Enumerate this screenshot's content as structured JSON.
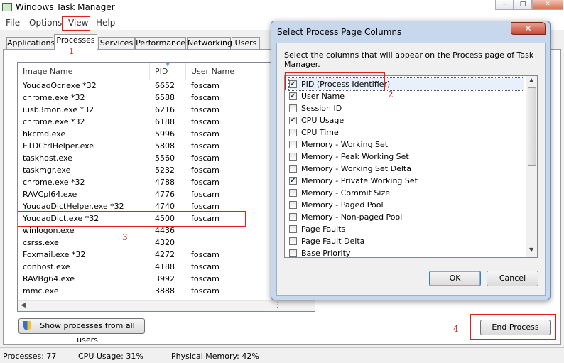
{
  "window": {
    "title": "Windows Task Manager"
  },
  "caption_buttons": [
    "–",
    "□",
    "✕"
  ],
  "menu": [
    "File",
    "Options",
    "View",
    "Help"
  ],
  "tabs": [
    "Applications",
    "Processes",
    "Services",
    "Performance",
    "Networking",
    "Users"
  ],
  "active_tab": "Processes",
  "columns": [
    "Image Name",
    "PID",
    "User Name"
  ],
  "processes": [
    {
      "name": "YoudaoOcr.exe *32",
      "pid": "6652",
      "user": "foscam"
    },
    {
      "name": "chrome.exe *32",
      "pid": "6588",
      "user": "foscam"
    },
    {
      "name": "iusb3mon.exe *32",
      "pid": "6216",
      "user": "foscam"
    },
    {
      "name": "chrome.exe *32",
      "pid": "6188",
      "user": "foscam"
    },
    {
      "name": "hkcmd.exe",
      "pid": "5996",
      "user": "foscam"
    },
    {
      "name": "ETDCtrlHelper.exe",
      "pid": "5808",
      "user": "foscam"
    },
    {
      "name": "taskhost.exe",
      "pid": "5560",
      "user": "foscam"
    },
    {
      "name": "taskmgr.exe",
      "pid": "5232",
      "user": "foscam"
    },
    {
      "name": "chrome.exe *32",
      "pid": "4788",
      "user": "foscam"
    },
    {
      "name": "RAVCpl64.exe",
      "pid": "4776",
      "user": "foscam"
    },
    {
      "name": "YoudaoDictHelper.exe *32",
      "pid": "4740",
      "user": "foscam"
    },
    {
      "name": "YoudaoDict.exe *32",
      "pid": "4500",
      "user": "foscam"
    },
    {
      "name": "winlogon.exe",
      "pid": "4436",
      "user": ""
    },
    {
      "name": "csrss.exe",
      "pid": "4320",
      "user": ""
    },
    {
      "name": "Foxmail.exe *32",
      "pid": "4272",
      "user": "foscam"
    },
    {
      "name": "conhost.exe",
      "pid": "4188",
      "user": "foscam"
    },
    {
      "name": "RAVBg64.exe",
      "pid": "3992",
      "user": "foscam"
    },
    {
      "name": "mmc.exe",
      "pid": "3888",
      "user": "foscam"
    }
  ],
  "buttons": {
    "show_all": "Show processes from all users",
    "end_process": "End Process"
  },
  "status": {
    "processes": "Processes: 77",
    "cpu": "CPU Usage: 31%",
    "memory": "Physical Memory: 42%"
  },
  "annotations": [
    "1",
    "2",
    "3",
    "4"
  ],
  "dialog": {
    "title": "Select Process Page Columns",
    "description": "Select the columns that will appear on the Process page of Task Manager.",
    "columns": [
      {
        "label": "PID (Process Identifier)",
        "checked": true
      },
      {
        "label": "User Name",
        "checked": true
      },
      {
        "label": "Session ID",
        "checked": false
      },
      {
        "label": "CPU Usage",
        "checked": true
      },
      {
        "label": "CPU Time",
        "checked": false
      },
      {
        "label": "Memory - Working Set",
        "checked": false
      },
      {
        "label": "Memory - Peak Working Set",
        "checked": false
      },
      {
        "label": "Memory - Working Set Delta",
        "checked": false
      },
      {
        "label": "Memory - Private Working Set",
        "checked": true
      },
      {
        "label": "Memory - Commit Size",
        "checked": false
      },
      {
        "label": "Memory - Paged Pool",
        "checked": false
      },
      {
        "label": "Memory - Non-paged Pool",
        "checked": false
      },
      {
        "label": "Page Faults",
        "checked": false
      },
      {
        "label": "Page Fault Delta",
        "checked": false
      },
      {
        "label": "Base Priority",
        "checked": false
      }
    ],
    "ok": "OK",
    "cancel": "Cancel",
    "close": "✕"
  },
  "colors": {
    "annotation_red": "#e0201c",
    "dialog_frame": "#c7d8ec",
    "close_button": "#c84a32"
  }
}
